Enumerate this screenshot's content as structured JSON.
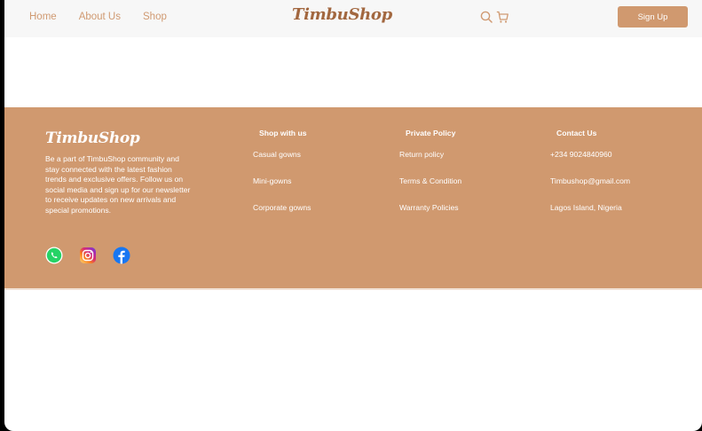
{
  "nav": {
    "links": [
      "Home",
      "About Us",
      "Shop"
    ],
    "brand": "TimbuShop",
    "signup_label": "Sign Up",
    "icons": [
      "search-icon",
      "cart-icon"
    ]
  },
  "footer": {
    "brand": "TimbuShop",
    "about": "Be a part of TimbuShop community and stay connected with the latest fashion trends and exclusive offers. Follow us on social media and sign up for our newsletter to receive updates on new arrivals and special promotions.",
    "social": [
      "whatsapp-icon",
      "instagram-icon",
      "facebook-icon"
    ],
    "columns": [
      {
        "title": "Shop with us",
        "items": [
          "Casual gowns",
          "Mini-gowns",
          "Corporate gowns"
        ]
      },
      {
        "title": "Private Policy",
        "items": [
          "Return policy",
          "Terms & Condition",
          "Warranty Policies"
        ]
      },
      {
        "title": "Contact Us",
        "items": [
          "+234 9024840960",
          "Timbushop@gmail.com",
          "Lagos Island, Nigeria"
        ]
      }
    ]
  },
  "colors": {
    "accent": "#d0996f",
    "brand_text": "#a2673f",
    "nav_bg": "#f7f7f7"
  }
}
